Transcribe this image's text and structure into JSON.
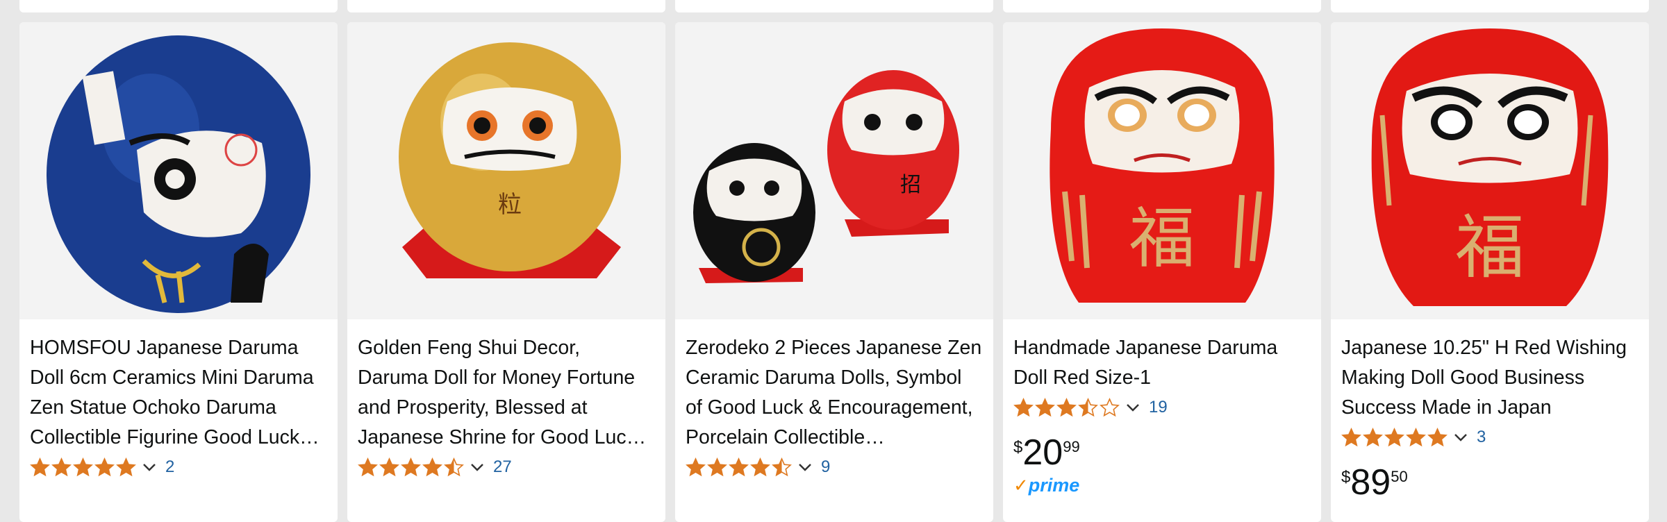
{
  "products": [
    {
      "title": "HOMSFOU Japanese Daruma Doll 6cm Ceramics Mini Daruma Zen Statue Ochoko Daruma Collectible Figurine Good Luck…",
      "rating": 5,
      "reviews": "2",
      "price": null,
      "image": "blue-daruma-image"
    },
    {
      "title": "Golden Feng Shui Decor, Daruma Doll for Money Fortune and Prosperity, Blessed at Japanese Shrine for Good Luc…",
      "rating": 4.5,
      "reviews": "27",
      "price": null,
      "image": "gold-daruma-image"
    },
    {
      "title": "Zerodeko 2 Pieces Japanese Zen Ceramic Daruma Dolls, Symbol of Good Luck & Encouragement, Porcelain Collectible…",
      "rating": 4.5,
      "reviews": "9",
      "price": null,
      "image": "two-daruma-image"
    },
    {
      "title": "Handmade Japanese Daruma Doll Red Size-1",
      "rating": 3.5,
      "reviews": "19",
      "price": {
        "symbol": "$",
        "whole": "20",
        "fraction": "99"
      },
      "prime": {
        "check": "✓",
        "label": "prime"
      },
      "image": "red-daruma-image"
    },
    {
      "title": "Japanese 10.25\" H Red Wishing Making Doll Good Business Success Made in Japan",
      "rating": 5,
      "reviews": "3",
      "price": {
        "symbol": "$",
        "whole": "89",
        "fraction": "50"
      },
      "image": "large-red-daruma-image"
    }
  ],
  "colors": {
    "star": "#de7921",
    "link": "#2162a1",
    "prime_blue": "#1a98ff",
    "prime_check": "#f08804"
  }
}
